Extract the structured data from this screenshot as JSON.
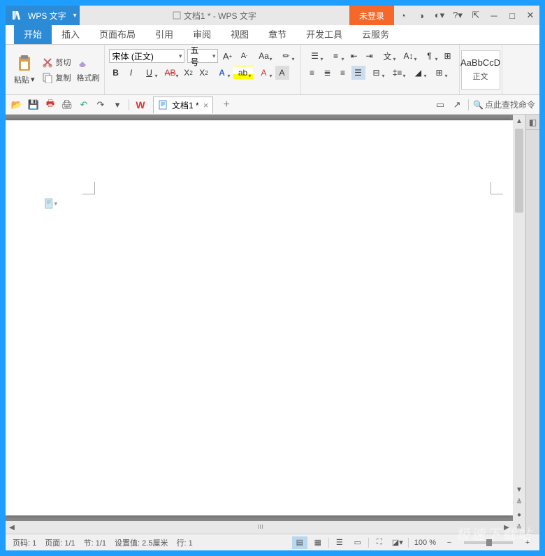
{
  "titlebar": {
    "app_name": "WPS 文字",
    "doc_title": "文档1 * - WPS 文字",
    "login_label": "未登录"
  },
  "menu": {
    "tabs": [
      "开始",
      "插入",
      "页面布局",
      "引用",
      "审阅",
      "视图",
      "章节",
      "开发工具",
      "云服务"
    ]
  },
  "ribbon": {
    "paste_label": "粘贴",
    "cut_label": "剪切",
    "copy_label": "复制",
    "format_painter_label": "格式刷",
    "font_name": "宋体 (正文)",
    "font_size": "五号",
    "style_preview": "AaBbCcD",
    "style_name": "正文"
  },
  "doctab": {
    "name": "文档1 *"
  },
  "search": {
    "placeholder": "点此查找命令"
  },
  "status": {
    "page_no": "页码: 1",
    "page_count": "页面: 1/1",
    "section": "节: 1/1",
    "setting": "设置值: 2.5厘米",
    "line": "行: 1",
    "zoom": "100 %"
  },
  "watermark": "极速下载站"
}
